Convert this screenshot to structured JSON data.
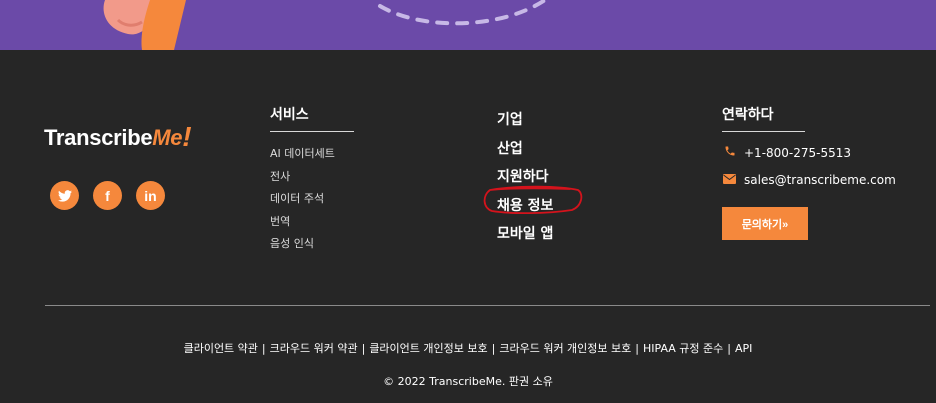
{
  "logo": {
    "main": "Transcribe",
    "accent": "Me",
    "bang": "!"
  },
  "social": [
    {
      "icon": "twitter-icon",
      "glyph": "t"
    },
    {
      "icon": "facebook-icon",
      "glyph": "f"
    },
    {
      "icon": "linkedin-icon",
      "glyph": "in"
    }
  ],
  "services": {
    "title": "서비스",
    "items": [
      "AI 데이터세트",
      "전사",
      "데이터 주석",
      "번역",
      "음성 인식"
    ]
  },
  "company": {
    "items": [
      "기업",
      "산업",
      "지원하다",
      "채용 정보",
      "모바일 앱"
    ]
  },
  "contact": {
    "title": "연락하다",
    "phone": "+1-800-275-5513",
    "email": "sales@transcribeme.com",
    "button": "문의하기»"
  },
  "legal_links": [
    "클라이언트 약관",
    "크라우드 워커 약관",
    "클라이언트 개인정보 보호",
    "크라우드 워커 개인정보 보호",
    "HIPAA 규정 준수",
    "API"
  ],
  "legal_separator": "|",
  "copyright": "© 2022 TranscribeMe. 판권 소유",
  "colors": {
    "accent": "#f5883c",
    "hero": "#6b4aa8",
    "footer_bg": "#262626",
    "annotation": "#d4131c"
  }
}
